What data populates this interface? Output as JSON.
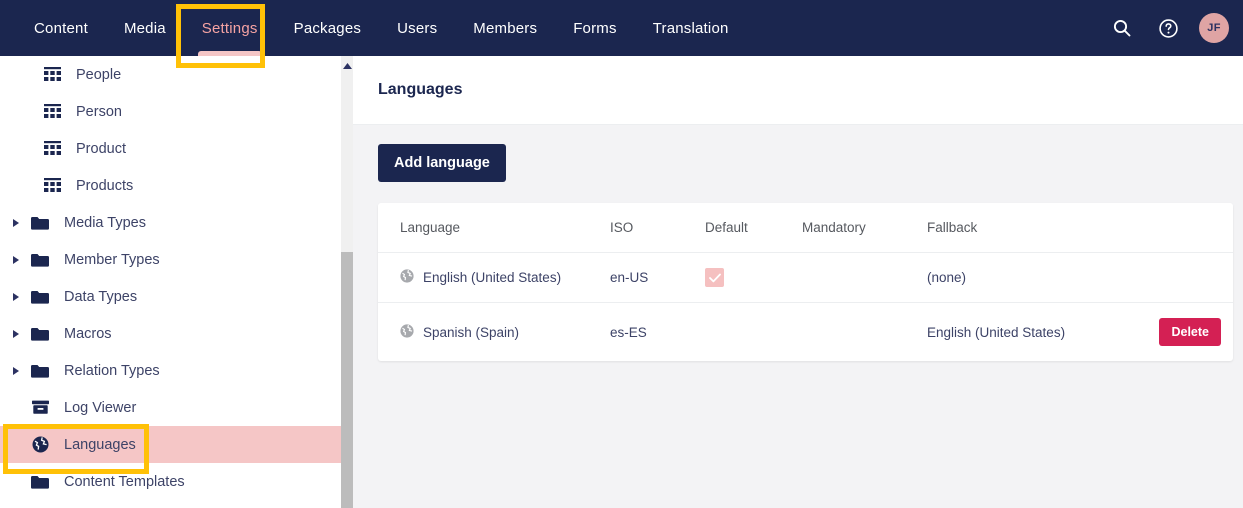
{
  "navbar": {
    "tabs": [
      {
        "label": "Content",
        "active": false
      },
      {
        "label": "Media",
        "active": false
      },
      {
        "label": "Settings",
        "active": true
      },
      {
        "label": "Packages",
        "active": false
      },
      {
        "label": "Users",
        "active": false
      },
      {
        "label": "Members",
        "active": false
      },
      {
        "label": "Forms",
        "active": false
      },
      {
        "label": "Translation",
        "active": false
      }
    ],
    "search_icon": "search-icon",
    "help_icon": "help-circle-icon",
    "avatar_initials": "JF",
    "avatar_color": "#dfa4a4",
    "background_color": "#1b264f",
    "active_tab_color": "#f5a3a3"
  },
  "sidebar": {
    "items": [
      {
        "label": "People",
        "icon": "grid-icon",
        "caret": false,
        "indent": true,
        "highlighted": false
      },
      {
        "label": "Person",
        "icon": "grid-icon",
        "caret": false,
        "indent": true,
        "highlighted": false
      },
      {
        "label": "Product",
        "icon": "grid-icon",
        "caret": false,
        "indent": true,
        "highlighted": false
      },
      {
        "label": "Products",
        "icon": "grid-icon",
        "caret": false,
        "indent": true,
        "highlighted": false
      },
      {
        "label": "Media Types",
        "icon": "folder-icon",
        "caret": true,
        "indent": false,
        "highlighted": false
      },
      {
        "label": "Member Types",
        "icon": "folder-icon",
        "caret": true,
        "indent": false,
        "highlighted": false
      },
      {
        "label": "Data Types",
        "icon": "folder-icon",
        "caret": true,
        "indent": false,
        "highlighted": false
      },
      {
        "label": "Macros",
        "icon": "folder-icon",
        "caret": true,
        "indent": false,
        "highlighted": false
      },
      {
        "label": "Relation Types",
        "icon": "folder-icon",
        "caret": true,
        "indent": false,
        "highlighted": false
      },
      {
        "label": "Log Viewer",
        "icon": "archive-icon",
        "caret": false,
        "indent": false,
        "highlighted": false
      },
      {
        "label": "Languages",
        "icon": "globe-icon",
        "caret": false,
        "indent": false,
        "highlighted": true
      },
      {
        "label": "Content Templates",
        "icon": "folder-icon",
        "caret": false,
        "indent": false,
        "highlighted": false
      }
    ],
    "highlight_color": "#f5c6c6",
    "scrollbar": {
      "up_arrow_icon": "caret-up-icon",
      "thumb_color": "#bcbcbc"
    }
  },
  "main": {
    "title": "Languages",
    "add_button_label": "Add language",
    "table": {
      "headers": [
        "Language",
        "ISO",
        "Default",
        "Mandatory",
        "Fallback"
      ],
      "rows": [
        {
          "icon": "globe-icon",
          "language": "English (United States)",
          "iso": "en-US",
          "default_checked": true,
          "mandatory_checked": false,
          "fallback": "(none)",
          "delete_label": ""
        },
        {
          "icon": "globe-icon",
          "language": "Spanish (Spain)",
          "iso": "es-ES",
          "default_checked": false,
          "mandatory_checked": false,
          "fallback": "English (United States)",
          "delete_label": "Delete"
        }
      ]
    },
    "delete_button_color": "#d42054",
    "checkbox_color": "#f5c0c0"
  },
  "annotations": {
    "color": "#ffc107",
    "boxes": [
      "settings-tab",
      "languages-sidebar-item"
    ]
  }
}
